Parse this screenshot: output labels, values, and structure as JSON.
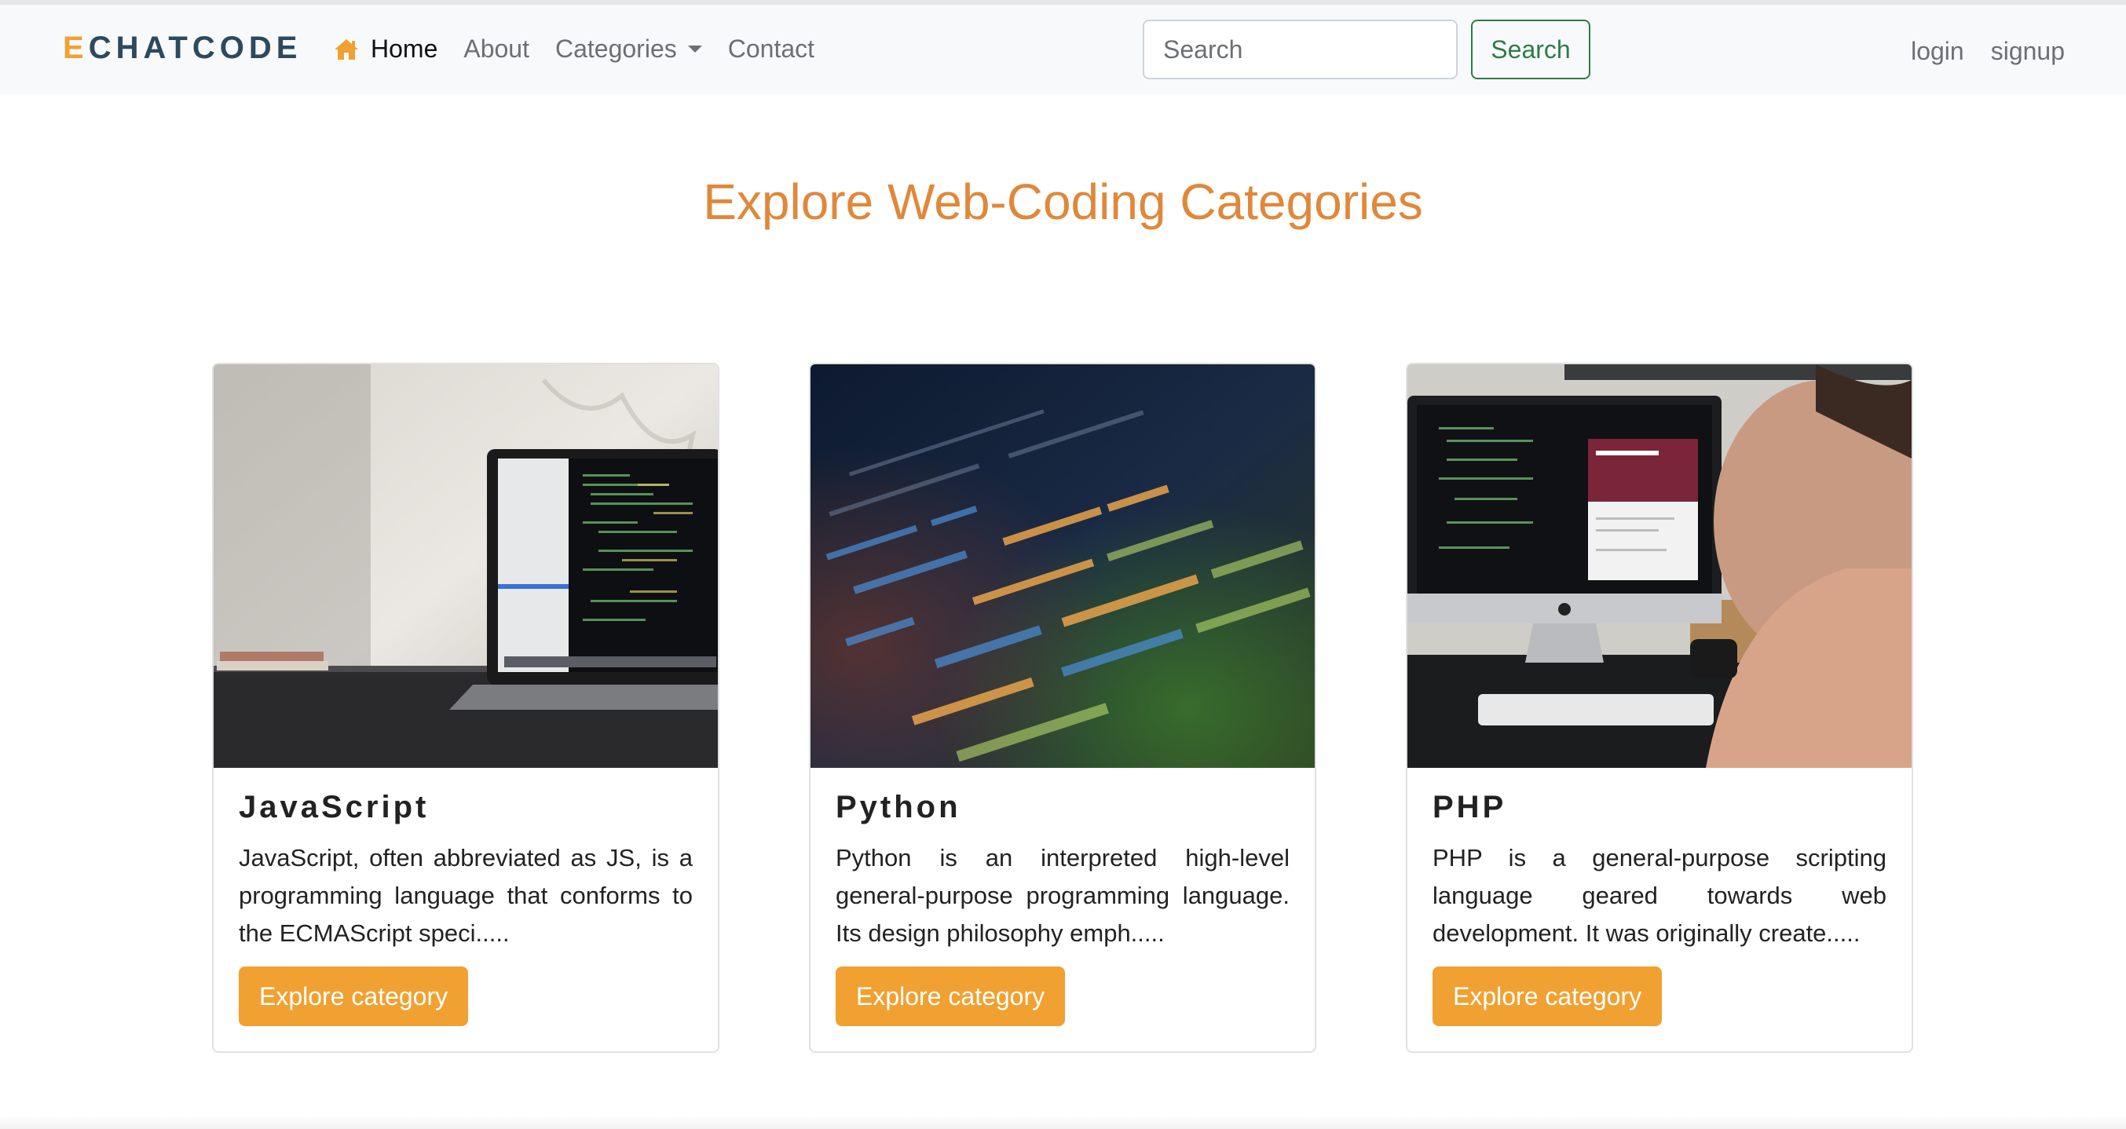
{
  "navbar": {
    "brand_first": "E",
    "brand_rest": "CHATCODE",
    "links": {
      "home": "Home",
      "about": "About",
      "categories": "Categories",
      "contact": "Contact"
    },
    "search": {
      "placeholder": "Search",
      "button": "Search"
    },
    "auth": {
      "login": "login",
      "signup": "signup"
    }
  },
  "page": {
    "heading": "Explore Web-Coding Categories"
  },
  "cards": [
    {
      "title": "JavaScript",
      "text": "JavaScript, often abbreviated as JS, is a programming language that conforms to the ECMAScript speci.....",
      "button": "Explore category",
      "image": "laptop-on-desk-photo"
    },
    {
      "title": "Python",
      "text": "Python is an interpreted high-level general-purpose programming language. Its design philosophy emph.....",
      "button": "Explore category",
      "image": "blurred-code-screen-photo"
    },
    {
      "title": "PHP",
      "text": "PHP is a general-purpose scripting language geared towards web development. It was originally create.....",
      "button": "Explore category",
      "image": "person-at-imac-photo"
    }
  ],
  "colors": {
    "brand_accent": "#f0a132",
    "brand_dark": "#2b4a5f",
    "heading": "#e0883a",
    "search_button": "#2f7a4a",
    "nav_background": "#f8f9fa"
  },
  "icons": {
    "home": "home-icon",
    "categories_dropdown": "caret-down-icon"
  }
}
